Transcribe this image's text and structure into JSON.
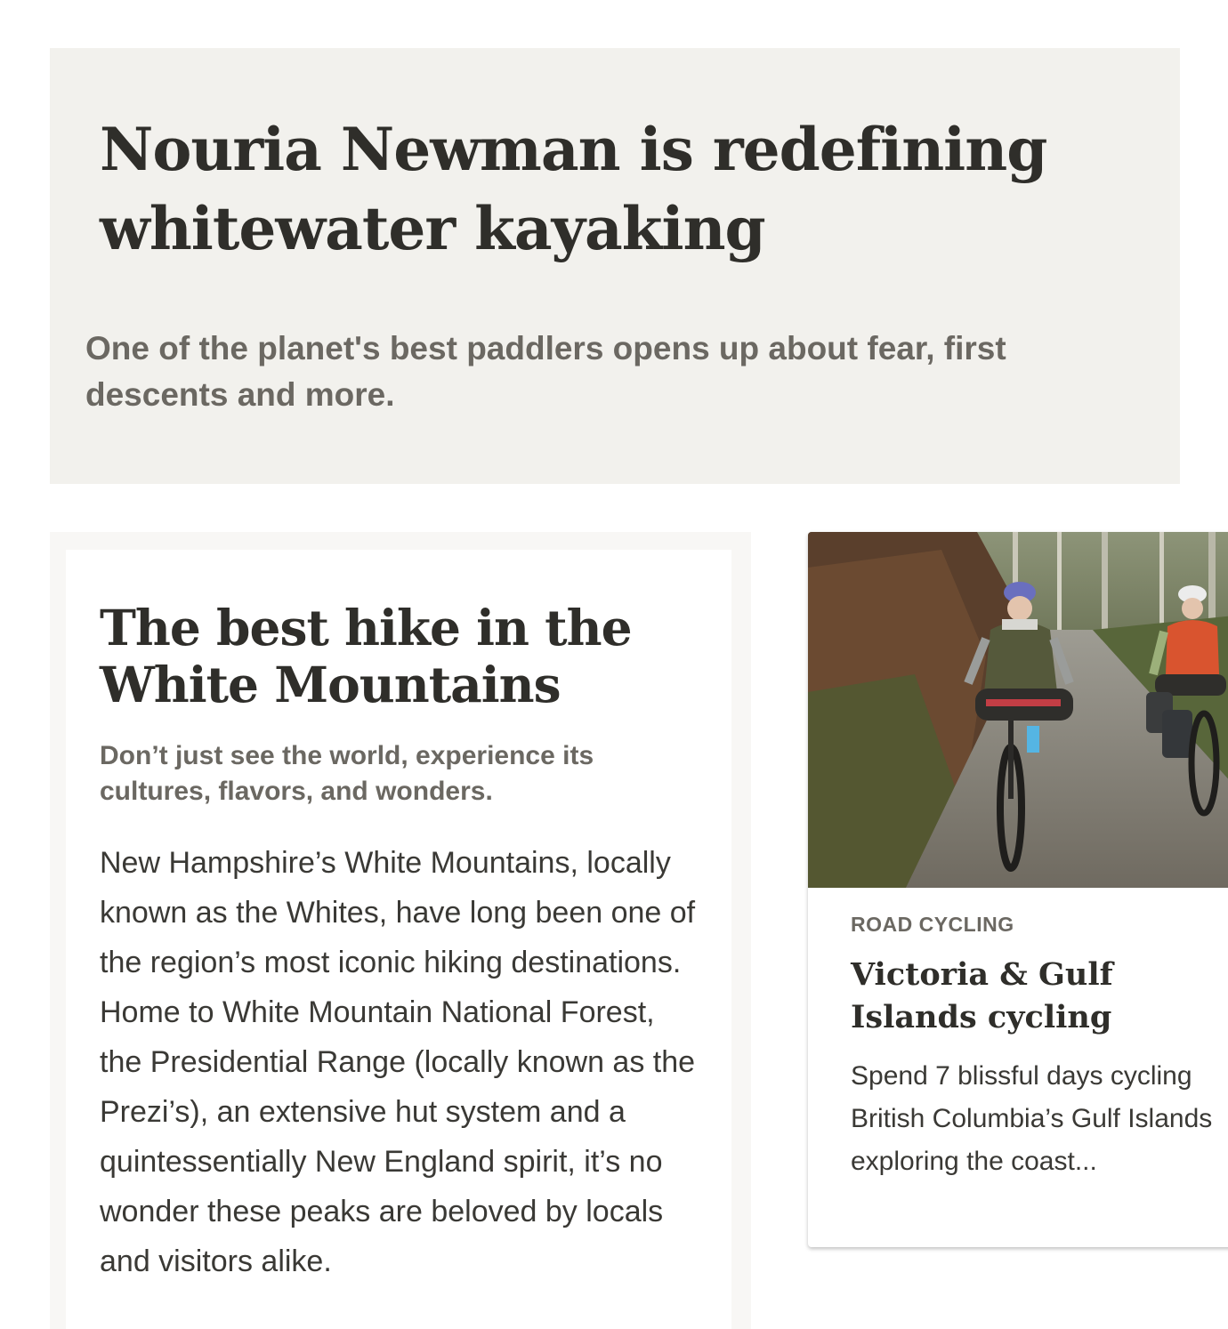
{
  "hero": {
    "title": "Nouria Newman is redefining whitewater kayaking",
    "subtitle": "One of the planet's best paddlers opens up about fear, first descents and more."
  },
  "article": {
    "title": "The best hike in the White Mountains",
    "dek": "Don’t just see the world, experience its cultures, flavors, and wonders.",
    "body": "New Hampshire’s White Mountains, locally known as the Whites, have long been one of the region’s most iconic hiking destinations. Home to White Mountain National Forest, the Presidential Range (locally known as the Prezi’s), an extensive hut system and a quintessentially New England spirit, it’s no wonder these peaks are beloved by locals and visitors alike."
  },
  "trip": {
    "image_icon": "cyclists-photo",
    "eyebrow": "ROAD CYCLING",
    "title": "Victoria & Gulf Islands cycling",
    "description": "Spend 7 blissful days cycling\nBritish Columbia’s Gulf Islands\nexploring the coast..."
  },
  "colors": {
    "hero_bg": "#f2f1ed",
    "heading": "#2f2e2a",
    "muted": "#6b6862",
    "body": "#3a3935"
  }
}
